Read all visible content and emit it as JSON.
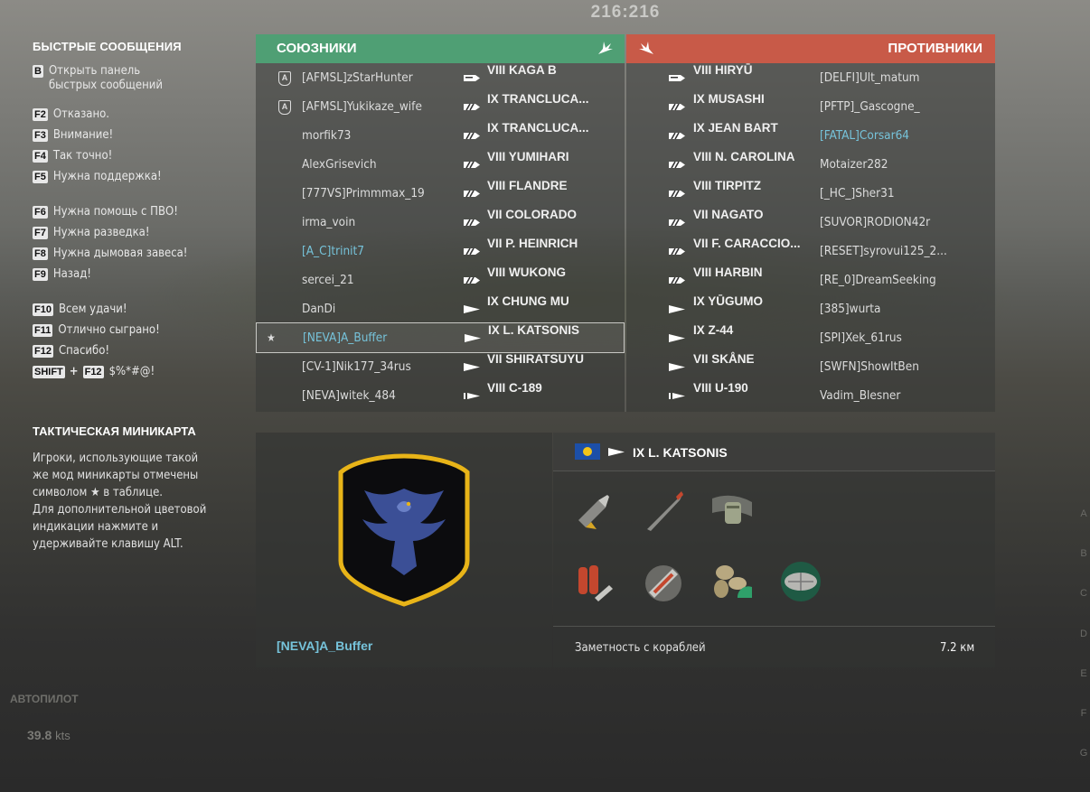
{
  "score": "216:216",
  "help": {
    "title": "БЫСТРЫЕ СООБЩЕНИЯ",
    "open_key": "B",
    "open_text_1": "Открыть панель",
    "open_text_2": "быстрых сообщений",
    "messages": [
      {
        "key": "F2",
        "text": "Отказано."
      },
      {
        "key": "F3",
        "text": "Внимание!"
      },
      {
        "key": "F4",
        "text": "Так точно!"
      },
      {
        "key": "F5",
        "text": "Нужна поддержка!"
      },
      {
        "key": "F6",
        "text": "Нужна помощь с ПВО!"
      },
      {
        "key": "F7",
        "text": "Нужна разведка!"
      },
      {
        "key": "F8",
        "text": "Нужна дымовая завеса!"
      },
      {
        "key": "F9",
        "text": "Назад!"
      },
      {
        "key": "F10",
        "text": "Всем удачи!"
      },
      {
        "key": "F11",
        "text": "Отлично сыграно!"
      },
      {
        "key": "F12",
        "text": "Спасибо!"
      }
    ],
    "combo_key_1": "SHIFT",
    "combo_plus": "+",
    "combo_key_2": "F12",
    "combo_text": "$%*#@!"
  },
  "tactical": {
    "title": "ТАКТИЧЕСКАЯ МИНИКАРТА",
    "line1": "Игроки, использующие такой",
    "line2": "же мод миникарты отмечены",
    "line3": "символом ★ в таблице.",
    "line4": "Для дополнительной цветовой",
    "line5": "индикации нажмите и",
    "line6": "удерживайте клавишу ALT."
  },
  "teams": {
    "ally_title": "СОЮЗНИКИ",
    "enemy_title": "ПРОТИВНИКИ",
    "allies": [
      {
        "player": "[AFMSL]zStarHunter",
        "ship": "VIII  KAGA B",
        "cls": "cv",
        "division": "A",
        "clan_color": false
      },
      {
        "player": "[AFMSL]Yukikaze_wife",
        "ship": "IX  TRANCLUCA...",
        "cls": "bb",
        "division": "A",
        "clan_color": false
      },
      {
        "player": "morfik73",
        "ship": "IX  TRANCLUCA...",
        "cls": "bb",
        "division": "",
        "clan_color": false
      },
      {
        "player": "AlexGrisevich",
        "ship": "VIII  YUMIHARI",
        "cls": "bb",
        "division": "",
        "clan_color": false
      },
      {
        "player": "[777VS]Primmmax_19",
        "ship": "VIII  FLANDRE",
        "cls": "bb",
        "division": "",
        "clan_color": false
      },
      {
        "player": "irma_voin",
        "ship": "VII  COLORADO",
        "cls": "bb",
        "division": "",
        "clan_color": false
      },
      {
        "player": "[A_C]trinit7",
        "ship": "VII  P. HEINRICH",
        "cls": "bb",
        "division": "",
        "clan_color": true
      },
      {
        "player": "sercei_21",
        "ship": "VIII  WUKONG",
        "cls": "bb",
        "division": "",
        "clan_color": false
      },
      {
        "player": "DanDi",
        "ship": "IX  CHUNG MU",
        "cls": "dd",
        "division": "",
        "clan_color": false
      },
      {
        "player": "[NEVA]A_Buffer",
        "ship": "IX  L. KATSONIS",
        "cls": "dd",
        "division": "",
        "clan_color": true,
        "star": "★",
        "selected": true
      },
      {
        "player": "[CV-1]Nik177_34rus",
        "ship": "VII  SHIRATSUYU",
        "cls": "dd",
        "division": "",
        "clan_color": false
      },
      {
        "player": "[NEVA]witek_484",
        "ship": "VIII  C-189",
        "cls": "ss",
        "division": "",
        "clan_color": false
      }
    ],
    "enemies": [
      {
        "player": "[DELFI]Ult_matum",
        "ship": "VIII  HIRYŪ",
        "cls": "cv",
        "clan_color": false
      },
      {
        "player": "[PFTP]_Gascogne_",
        "ship": "IX  MUSASHI",
        "cls": "bb",
        "clan_color": false
      },
      {
        "player": "[FATAL]Corsar64",
        "ship": "IX  JEAN BART",
        "cls": "bb",
        "clan_color": true
      },
      {
        "player": "Motaizer282",
        "ship": "VIII  N. CAROLINA",
        "cls": "bb",
        "clan_color": false
      },
      {
        "player": "[_HC_]Sher31",
        "ship": "VIII  TIRPITZ",
        "cls": "bb",
        "clan_color": false
      },
      {
        "player": "[SUVOR]RODION42r",
        "ship": "VII  NAGATO",
        "cls": "bb",
        "clan_color": false
      },
      {
        "player": "[RESET]syrovui125_2...",
        "ship": "VII  F. CARACCIO...",
        "cls": "bb",
        "clan_color": false
      },
      {
        "player": "[RE_0]DreamSeeking",
        "ship": "VIII  HARBIN",
        "cls": "bb",
        "clan_color": false
      },
      {
        "player": "[385]wurta",
        "ship": "IX  YŪGUMO",
        "cls": "dd",
        "clan_color": false
      },
      {
        "player": "[SPI]Xek_61rus",
        "ship": "IX  Z-44",
        "cls": "dd",
        "clan_color": false
      },
      {
        "player": "[SWFN]ShowItBen",
        "ship": "VII  SKÅNE",
        "cls": "dd",
        "clan_color": false
      },
      {
        "player": "Vadim_Blesner",
        "ship": "VIII  U-190",
        "cls": "ss",
        "clan_color": false
      }
    ]
  },
  "selected": {
    "player": "[NEVA]A_Buffer",
    "ship": "IX  L. KATSONIS",
    "detect_label": "Заметность с кораблей",
    "detect_value": "7.2 км",
    "modules": [
      "ammo-upgrade-icon",
      "torpedo-upgrade-icon",
      "consumable-canister-icon",
      "damage-control-icon",
      "smoke-generator-icon",
      "propulsion-icon",
      "hydroacoustic-icon"
    ],
    "colors": {
      "flag_blue": "#1c4fa8",
      "flag_yellow": "#f2c418",
      "patch_gold": "#e8b418",
      "clan_cyan": "#76c3da"
    }
  },
  "hud": {
    "autopilot": "АВТОПИЛОТ",
    "speed_value": "39.8",
    "speed_unit": "kts",
    "grid_letters": [
      "A",
      "B",
      "C",
      "D",
      "E",
      "F",
      "G"
    ]
  },
  "colors": {
    "ally_header": "#4f9f74",
    "enemy_header": "#c85a48"
  }
}
